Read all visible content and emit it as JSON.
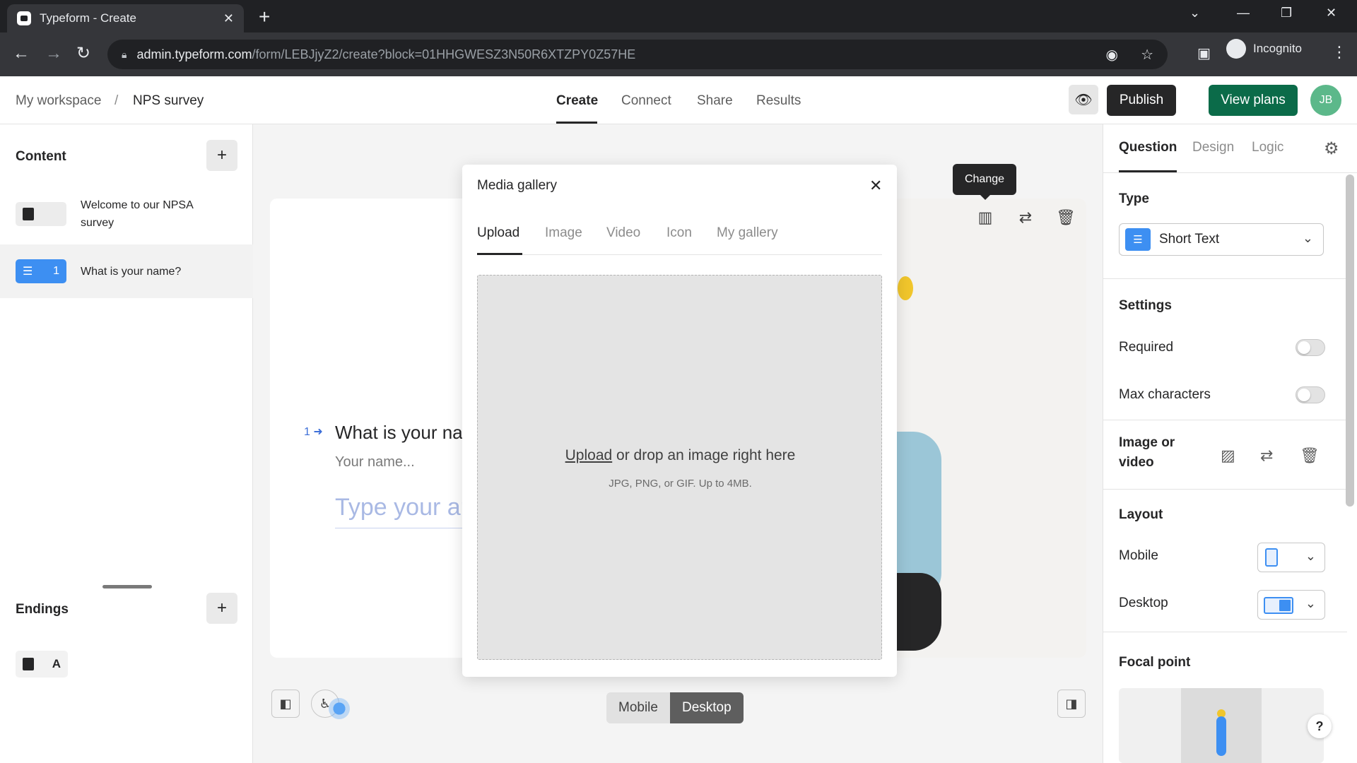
{
  "browser": {
    "tab_title": "Typeform - Create",
    "url_host": "admin.typeform.com",
    "url_path": "/form/LEBJjyZ2/create?block=01HHGWESZ3N50R6XTZPY0Z57HE",
    "profile_label": "Incognito"
  },
  "header": {
    "breadcrumb_root": "My workspace",
    "breadcrumb_sep": "/",
    "breadcrumb_form": "NPS survey",
    "nav": [
      "Create",
      "Connect",
      "Share",
      "Results"
    ],
    "publish_label": "Publish",
    "plans_label": "View plans",
    "avatar_initials": "JB",
    "colors": {
      "publish": "#262627",
      "plans": "#0b6b49",
      "avatar": "#5cb88a"
    }
  },
  "sidebar": {
    "content_title": "Content",
    "items": [
      {
        "label": "Welcome to our NPSA survey",
        "type_icon": "welcome-screen-icon"
      },
      {
        "label": "What is your name?",
        "number": "1",
        "type_icon": "short-text-icon"
      }
    ],
    "endings_title": "Endings",
    "ending_badge": "A"
  },
  "canvas": {
    "question_number": "1",
    "question_text": "What is your na",
    "question_description": "Your name...",
    "answer_placeholder": "Type your ar",
    "tooltip": "Change",
    "device_toggle": [
      "Mobile",
      "Desktop"
    ],
    "active_device": "Desktop"
  },
  "modal": {
    "title": "Media gallery",
    "tabs": [
      "Upload",
      "Image",
      "Video",
      "Icon",
      "My gallery"
    ],
    "active_tab": "Upload",
    "upload_link": "Upload",
    "upload_text": " or drop an image right here",
    "upload_hint": "JPG, PNG, or GIF. Up to 4MB."
  },
  "right_panel": {
    "tabs": [
      "Question",
      "Design",
      "Logic"
    ],
    "active_tab": "Question",
    "type_label": "Type",
    "type_value": "Short Text",
    "settings_label": "Settings",
    "required_label": "Required",
    "required_on": false,
    "max_chars_label": "Max characters",
    "max_chars_on": false,
    "image_video_label_1": "Image or",
    "image_video_label_2": "video",
    "layout_label": "Layout",
    "layout_mobile_label": "Mobile",
    "layout_desktop_label": "Desktop",
    "focal_label": "Focal point",
    "accent_color": "#3d8ff2"
  },
  "help_label": "?"
}
